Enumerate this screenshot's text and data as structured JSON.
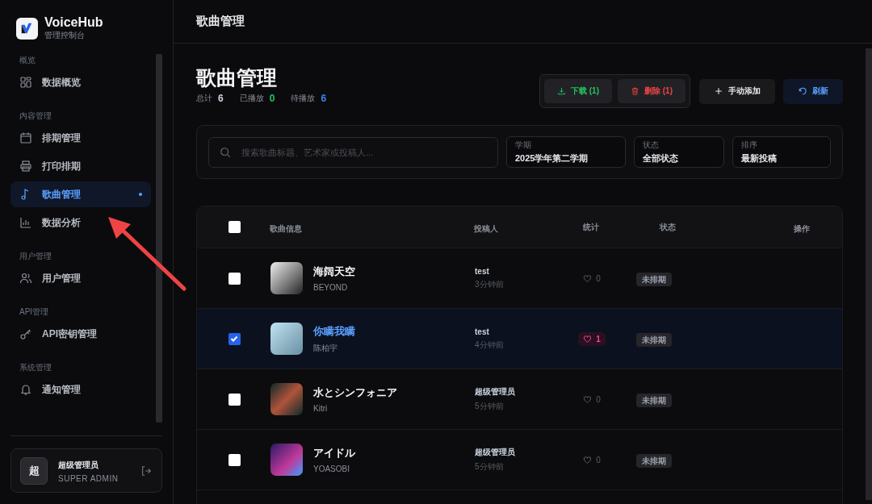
{
  "brand": {
    "name": "VoiceHub",
    "subtitle": "管理控制台"
  },
  "sidebar": {
    "sections": [
      {
        "title": "概览",
        "items": [
          {
            "label": "数据概览",
            "selected": false
          }
        ]
      },
      {
        "title": "内容管理",
        "items": [
          {
            "label": "排期管理",
            "selected": false
          },
          {
            "label": "打印排期",
            "selected": false
          },
          {
            "label": "歌曲管理",
            "selected": true
          },
          {
            "label": "数据分析",
            "selected": false
          }
        ]
      },
      {
        "title": "用户管理",
        "items": [
          {
            "label": "用户管理",
            "selected": false
          }
        ]
      },
      {
        "title": "API管理",
        "items": [
          {
            "label": "API密钥管理",
            "selected": false
          }
        ]
      },
      {
        "title": "系统管理",
        "items": [
          {
            "label": "通知管理",
            "selected": false
          }
        ]
      }
    ]
  },
  "user": {
    "avatar": "超",
    "name": "超级管理员",
    "role": "SUPER ADMIN"
  },
  "header": {
    "title": "歌曲管理"
  },
  "page": {
    "title": "歌曲管理",
    "stats": [
      {
        "label": "总计",
        "value": "6",
        "color": "#cbd5e1"
      },
      {
        "label": "已播放",
        "value": "0",
        "color": "#22c55e"
      },
      {
        "label": "待播放",
        "value": "6",
        "color": "#3b82f6"
      }
    ]
  },
  "actions": [
    {
      "kind": "download",
      "label": "下载 (1)"
    },
    {
      "kind": "delete",
      "label": "删除 (1)"
    },
    {
      "kind": "add",
      "label": "手动添加"
    },
    {
      "kind": "refresh",
      "label": "刷新"
    }
  ],
  "search": {
    "placeholder": "搜索歌曲标题、艺术家或投稿人..."
  },
  "filters": [
    {
      "label": "学期",
      "value": "2025学年第二学期"
    },
    {
      "label": "状态",
      "value": "全部状态"
    },
    {
      "label": "排序",
      "value": "最新投稿"
    }
  ],
  "table": {
    "select_all": {
      "checked": false
    },
    "columns": [
      "歌曲信息",
      "投稿人",
      "统计",
      "状态",
      "操作"
    ],
    "rows": [
      {
        "selected": false,
        "title": "海阔天空",
        "artist": "BEYOND",
        "submitter": "test",
        "time": "3分钟前",
        "likes": "0",
        "liked": false,
        "status": "未排期"
      },
      {
        "selected": true,
        "title": "你瞒我瞒",
        "artist": "陈柏宇",
        "submitter": "test",
        "time": "4分钟前",
        "likes": "1",
        "liked": true,
        "status": "未排期"
      },
      {
        "selected": false,
        "title": "水とシンフォニア",
        "artist": "Kitri",
        "submitter": "超级管理员",
        "time": "5分钟前",
        "likes": "0",
        "liked": false,
        "status": "未排期"
      },
      {
        "selected": false,
        "title": "アイドル",
        "artist": "YOASOBI",
        "submitter": "超级管理员",
        "time": "5分钟前",
        "likes": "0",
        "liked": false,
        "status": "未排期"
      }
    ]
  }
}
